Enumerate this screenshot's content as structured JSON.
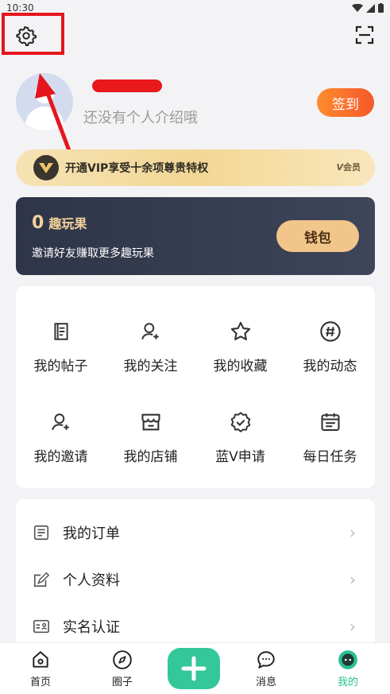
{
  "status_bar": {
    "time": "10:30"
  },
  "profile": {
    "bio": "还没有个人介绍哦",
    "signin_label": "签到"
  },
  "vip": {
    "text": "开通VIP享受十余项尊贵特权",
    "tag": "会员"
  },
  "wallet": {
    "amount": "0",
    "unit": "趣玩果",
    "desc": "邀请好友赚取更多趣玩果",
    "button": "钱包"
  },
  "grid": {
    "items": [
      {
        "label": "我的帖子",
        "icon": "posts-icon"
      },
      {
        "label": "我的关注",
        "icon": "follow-icon"
      },
      {
        "label": "我的收藏",
        "icon": "star-icon"
      },
      {
        "label": "我的动态",
        "icon": "hashtag-icon"
      },
      {
        "label": "我的邀请",
        "icon": "invite-icon"
      },
      {
        "label": "我的店铺",
        "icon": "shop-icon"
      },
      {
        "label": "蓝V申请",
        "icon": "badge-icon"
      },
      {
        "label": "每日任务",
        "icon": "calendar-icon"
      }
    ]
  },
  "list": {
    "items": [
      {
        "label": "我的订单",
        "icon": "order-icon"
      },
      {
        "label": "个人资料",
        "icon": "edit-icon"
      },
      {
        "label": "实名认证",
        "icon": "id-card-icon"
      }
    ]
  },
  "nav": {
    "items": [
      {
        "label": "首页",
        "icon": "home-icon"
      },
      {
        "label": "圈子",
        "icon": "compass-icon"
      },
      {
        "label": "消息",
        "icon": "chat-icon"
      },
      {
        "label": "我的",
        "icon": "me-icon"
      }
    ],
    "active": "我的",
    "accent_color": "#2dbf93"
  },
  "colors": {
    "signin_gradient": [
      "#ff8b2d",
      "#f5582a"
    ],
    "wallet_bg": "#2f3548",
    "wallet_gold": "#f3d29a",
    "post_button": "#34c79a",
    "annotation_red": "#e5161d"
  }
}
